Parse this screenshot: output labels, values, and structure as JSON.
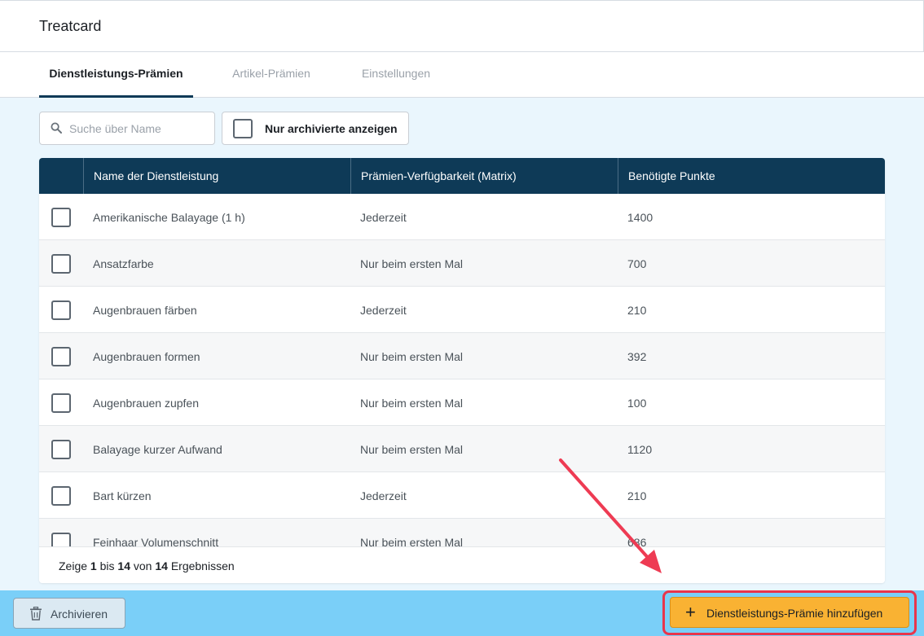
{
  "app": {
    "title": "Treatcard"
  },
  "tabs": [
    {
      "label": "Dienstleistungs-Prämien",
      "active": true
    },
    {
      "label": "Artikel-Prämien",
      "active": false
    },
    {
      "label": "Einstellungen",
      "active": false
    }
  ],
  "filters": {
    "search_placeholder": "Suche über Name",
    "search_value": "",
    "archived_label": "Nur archivierte anzeigen",
    "archived_checked": false
  },
  "table": {
    "headers": [
      "Name der Dienstleistung",
      "Prämien-Verfügbarkeit (Matrix)",
      "Benötigte Punkte"
    ],
    "rows": [
      {
        "name": "Amerikanische Balayage (1 h)",
        "availability": "Jederzeit",
        "points": "1400"
      },
      {
        "name": "Ansatzfarbe",
        "availability": "Nur beim ersten Mal",
        "points": "700"
      },
      {
        "name": "Augenbrauen färben",
        "availability": "Jederzeit",
        "points": "210"
      },
      {
        "name": "Augenbrauen formen",
        "availability": "Nur beim ersten Mal",
        "points": "392"
      },
      {
        "name": "Augenbrauen zupfen",
        "availability": "Nur beim ersten Mal",
        "points": "100"
      },
      {
        "name": "Balayage kurzer Aufwand",
        "availability": "Nur beim ersten Mal",
        "points": "1120"
      },
      {
        "name": "Bart kürzen",
        "availability": "Jederzeit",
        "points": "210"
      },
      {
        "name": "Feinhaar Volumenschnitt",
        "availability": "Nur beim ersten Mal",
        "points": "686"
      }
    ]
  },
  "pagination": {
    "prefix": "Zeige",
    "from": "1",
    "to_word": "bis",
    "to": "14",
    "of_word": "von",
    "total": "14",
    "suffix": "Ergebnissen"
  },
  "footer": {
    "archive_label": "Archivieren",
    "add_label": "Dienstleistungs-Prämie hinzufügen"
  },
  "icons": {
    "search": "search-icon",
    "archive": "trash-icon",
    "add": "plus-icon"
  },
  "colors": {
    "header_bg": "#0e3a57",
    "content_bg": "#eaf6fd",
    "footer_bg": "#7acff8",
    "primary_button": "#f9b233",
    "highlight": "#e8354b"
  }
}
